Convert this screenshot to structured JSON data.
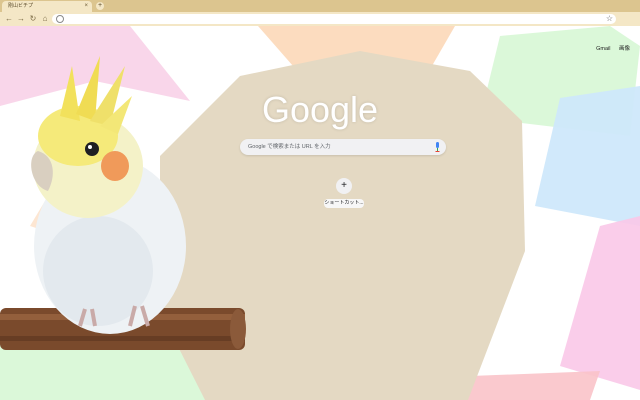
{
  "tab": {
    "title": "刚山ビチプ",
    "close": "×",
    "new_tab": "+"
  },
  "toolbar": {
    "back": "←",
    "forward": "→",
    "reload": "↻",
    "home": "⌂",
    "star": "☆"
  },
  "search": {
    "placeholder": "Google で検索または URL を入力"
  },
  "header": {
    "gmail": "Gmail",
    "images": "画像"
  },
  "logo": {
    "text": "Google"
  },
  "shortcut": {
    "add": "+",
    "label": "ショートカット..."
  },
  "icons": {
    "mic": "microphone-icon",
    "site": "google-g-icon"
  },
  "colors": {
    "tab_strip": "#dcc58f",
    "toolbar": "#f4e7c6",
    "center_panel": "#e4d9c3"
  }
}
